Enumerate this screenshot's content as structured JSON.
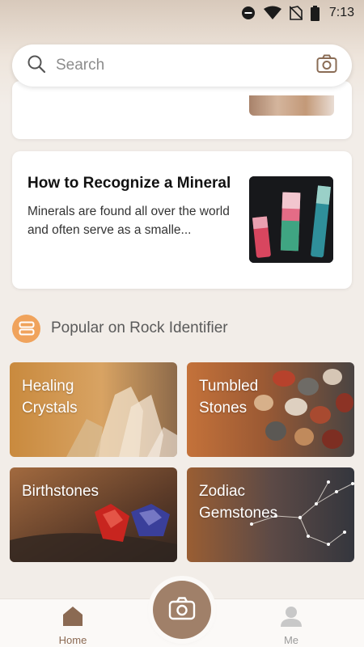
{
  "status_bar": {
    "time": "7:13"
  },
  "search": {
    "placeholder": "Search"
  },
  "article": {
    "title": "How to Recognize a Mineral",
    "description": "Minerals are found all over the world and often serve as a smalle..."
  },
  "section": {
    "title": "Popular on Rock Identifier"
  },
  "tiles": [
    {
      "label_line1": "Healing",
      "label_line2": "Crystals"
    },
    {
      "label_line1": "Tumbled",
      "label_line2": "Stones"
    },
    {
      "label_line1": "Birthstones",
      "label_line2": ""
    },
    {
      "label_line1": "Zodiac",
      "label_line2": "Gemstones"
    }
  ],
  "nav": {
    "home": "Home",
    "me": "Me"
  },
  "colors": {
    "accent": "#a08069",
    "badge": "#f0a35c",
    "home_active": "#8b6a53"
  },
  "icons": [
    "search-icon",
    "camera-icon",
    "home-icon",
    "person-icon",
    "grid-icon"
  ]
}
